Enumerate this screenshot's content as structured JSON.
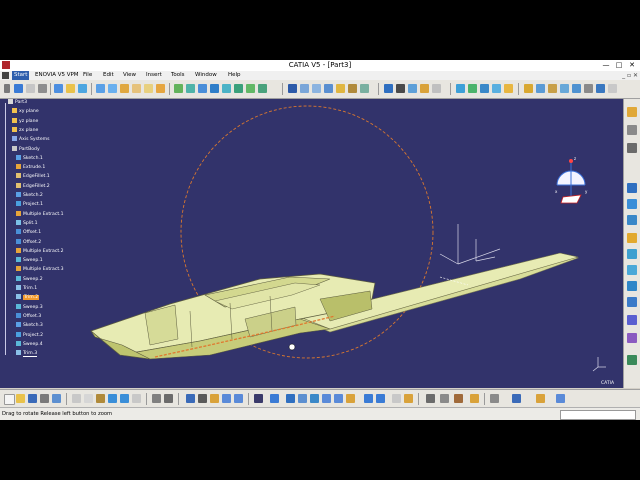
{
  "window": {
    "title": "CATIA V5 - [Part3]",
    "minimize": "—",
    "maximize": "□",
    "close": "✕"
  },
  "menu": {
    "items": [
      "Start",
      "ENOVIA V5 VPM",
      "File",
      "Edit",
      "View",
      "Insert",
      "Tools",
      "Window",
      "Help"
    ],
    "active": "Start",
    "doc_controls": "_ ▫ ✕"
  },
  "spec_tree": {
    "items": [
      {
        "label": "Part3",
        "icon": "part-icon",
        "level": 0
      },
      {
        "label": "xy plane",
        "icon": "plane-icon",
        "level": 1
      },
      {
        "label": "yz plane",
        "icon": "plane-icon",
        "level": 1
      },
      {
        "label": "zx plane",
        "icon": "plane-icon",
        "level": 1
      },
      {
        "label": "Axis Systems",
        "icon": "axis-system-icon",
        "level": 1
      },
      {
        "label": "PartBody",
        "icon": "body-icon",
        "level": 1
      },
      {
        "label": "Sketch.1",
        "icon": "sketch-icon",
        "level": 2
      },
      {
        "label": "Extrude.1",
        "icon": "extrude-icon",
        "level": 2
      },
      {
        "label": "EdgeFillet.1",
        "icon": "fillet-icon",
        "level": 2
      },
      {
        "label": "EdgeFillet.2",
        "icon": "fillet-icon",
        "level": 2
      },
      {
        "label": "Sketch.2",
        "icon": "sketch-icon",
        "level": 2
      },
      {
        "label": "Project.1",
        "icon": "project-icon",
        "level": 2
      },
      {
        "label": "Multiple Extract.1",
        "icon": "extract-icon",
        "level": 2
      },
      {
        "label": "Split.1",
        "icon": "split-icon",
        "level": 2
      },
      {
        "label": "Offset.1",
        "icon": "offset-icon",
        "level": 2
      },
      {
        "label": "Offset.2",
        "icon": "offset-icon",
        "level": 2
      },
      {
        "label": "Multiple Extract.2",
        "icon": "extract-icon",
        "level": 2
      },
      {
        "label": "Sweep.1",
        "icon": "sweep-icon",
        "level": 2
      },
      {
        "label": "Multiple Extract.3",
        "icon": "extract-icon",
        "level": 2
      },
      {
        "label": "Sweep.2",
        "icon": "sweep-icon",
        "level": 2
      },
      {
        "label": "Trim.1",
        "icon": "trim-icon",
        "level": 2
      },
      {
        "label": "Trim.2",
        "icon": "trim-icon",
        "level": 2,
        "highlighted": true
      },
      {
        "label": "Sweep.3",
        "icon": "sweep-icon",
        "level": 2
      },
      {
        "label": "Offset.3",
        "icon": "offset-icon",
        "level": 2
      },
      {
        "label": "Sketch.3",
        "icon": "sketch-icon",
        "level": 2
      },
      {
        "label": "Project.2",
        "icon": "project-icon",
        "level": 2
      },
      {
        "label": "Sweep.4",
        "icon": "sweep-icon",
        "level": 2
      },
      {
        "label": "Trim.3",
        "icon": "trim-icon",
        "level": 2,
        "underlined": true
      }
    ]
  },
  "compass": {
    "axis_labels": [
      "z",
      "x",
      "y"
    ]
  },
  "catia_logo": "CATIA",
  "status": {
    "message": "Drag to rotate  Release left button to zoom",
    "command_input": ""
  },
  "colors": {
    "viewport_bg": "#32336b",
    "part_fill": "#e7ebb3",
    "highlight": "#f29a2e",
    "rotation_circle": "#d9772f"
  }
}
